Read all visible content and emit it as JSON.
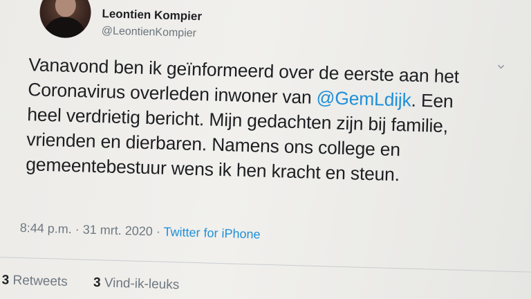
{
  "tweet": {
    "display_name": "Leontien Kompier",
    "handle": "@LeontienKompier",
    "text_lines": {
      "l1": "Vanavond ben ik geïnformeerd over de eerste aan het",
      "l2_pre": "Coronavirus overleden inwoner van ",
      "l2_mention": "@GemLdijk",
      "l2_post": ". Een",
      "l3": "heel verdrietig bericht. Mijn gedachten zijn bij familie,",
      "l4": "vrienden en dierbaren. Namens ons college en",
      "l5": "gemeentebestuur wens ik hen kracht en steun."
    },
    "time": "8:44 p.m.",
    "separator": " · ",
    "date": "31 mrt. 2020",
    "source": "Twitter for iPhone",
    "retweets_count": "3",
    "retweets_label": "Retweets",
    "likes_count": "3",
    "likes_label": "Vind-ik-leuks",
    "caret_icon": "chevron-down-icon",
    "colors": {
      "link": "#1f8fd8",
      "text": "#1d1f22",
      "muted": "#6e7880"
    }
  }
}
